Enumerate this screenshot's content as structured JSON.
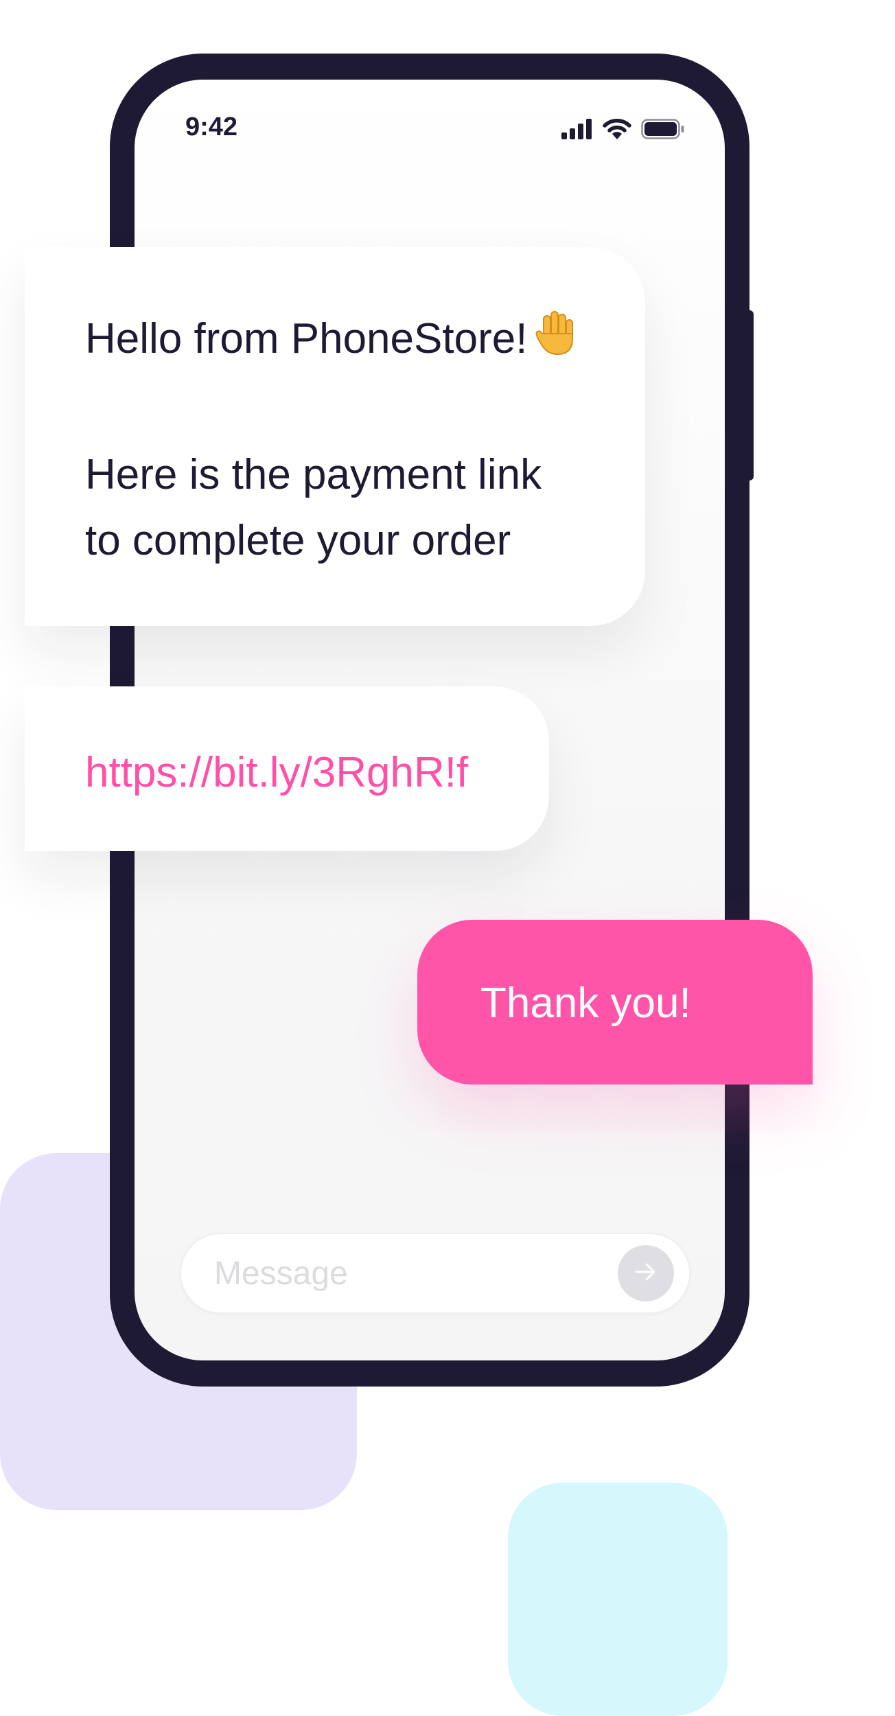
{
  "status_bar": {
    "time": "9:42",
    "icons": [
      "signal-icon",
      "wifi-icon",
      "battery-icon"
    ]
  },
  "chat": {
    "greeting": {
      "line1": "Hello from PhoneStore!",
      "emoji_icon": "raised-hand-icon",
      "line2": "Here is the payment link",
      "line3": "to complete your order"
    },
    "link": {
      "text": "https://bit.ly/3RghR!f"
    },
    "reply": {
      "text": "Thank you!"
    }
  },
  "composer": {
    "placeholder": "Message",
    "value": "",
    "send_icon": "arrow-right-icon"
  },
  "colors": {
    "accent": "#ff55a9",
    "link": "#ff4fa7",
    "phone_frame": "#1e1a33",
    "deco_lavender": "#e7e2f9",
    "deco_cyan": "#d4f8fb"
  }
}
